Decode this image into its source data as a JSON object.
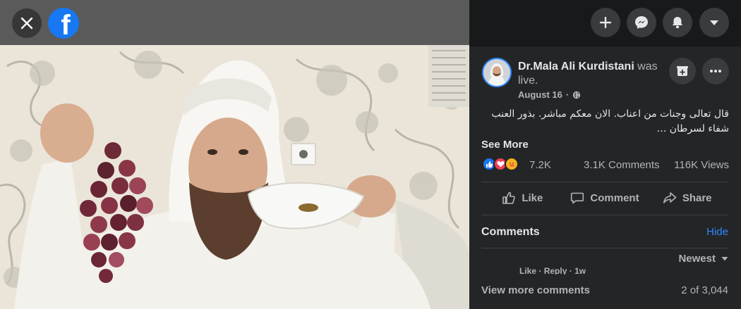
{
  "window": {
    "title": "Facebook"
  },
  "media": {
    "logo_letter": "f",
    "close_icon": "close-icon",
    "video_icon": "live-video-frame"
  },
  "topbar": {
    "buttons": [
      "plus-icon",
      "messenger-icon",
      "bell-icon",
      "caret-down-icon"
    ]
  },
  "post": {
    "author": "Dr.Mala Ali Kurdistani",
    "status": " was live.",
    "date": "August 16",
    "privacy_icon": "globe-icon",
    "text_line1": "قال تعالى وجنات من اعناب. الان معكم مباشر. بذور العنب",
    "text_line2": "شفاء لسرطان ...",
    "see_more": "See More"
  },
  "stats": {
    "reactions": [
      "like",
      "love",
      "care"
    ],
    "reaction_count": "7.2K",
    "comments": "3.1K Comments",
    "views": "116K Views"
  },
  "actions": {
    "like": "Like",
    "comment": "Comment",
    "share": "Share"
  },
  "comments": {
    "title": "Comments",
    "hide": "Hide",
    "sort": "Newest",
    "last_actions": {
      "like": "Like",
      "reply": "Reply",
      "time": "1w"
    },
    "view_more": "View more comments",
    "pager": "2 of 3,044"
  },
  "colors": {
    "panel_bg": "#242526",
    "topbar_bg": "#18191a",
    "accent": "#1877f2",
    "link": "#2d88ff",
    "text_primary": "#e4e6eb",
    "text_secondary": "#b0b3b8"
  }
}
